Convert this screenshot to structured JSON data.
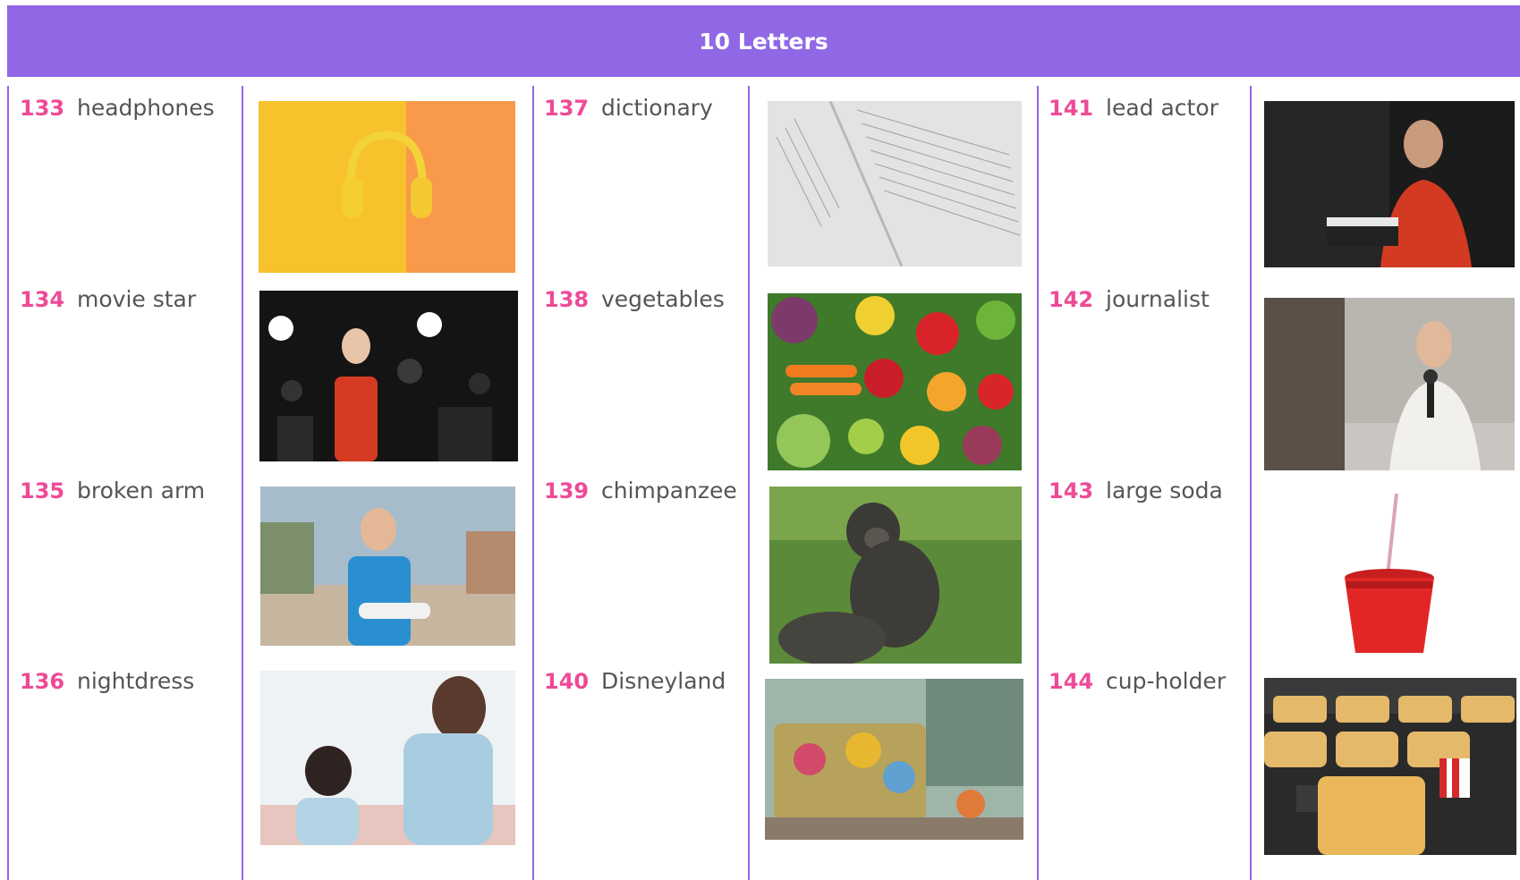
{
  "header": {
    "title": "10 Letters"
  },
  "columns": [
    {
      "items": [
        {
          "number": "133",
          "word": "headphones",
          "image": "headphones"
        },
        {
          "number": "134",
          "word": "movie star",
          "image": "movie-star"
        },
        {
          "number": "135",
          "word": "broken arm",
          "image": "broken-arm"
        },
        {
          "number": "136",
          "word": "nightdress",
          "image": "nightdress"
        }
      ]
    },
    {
      "items": [
        {
          "number": "137",
          "word": "dictionary",
          "image": "dictionary"
        },
        {
          "number": "138",
          "word": "vegetables",
          "image": "vegetables"
        },
        {
          "number": "139",
          "word": "chimpanzee",
          "image": "chimpanzee"
        },
        {
          "number": "140",
          "word": "Disneyland",
          "image": "disneyland"
        }
      ]
    },
    {
      "items": [
        {
          "number": "141",
          "word": "lead actor",
          "image": "lead-actor"
        },
        {
          "number": "142",
          "word": "journalist",
          "image": "journalist"
        },
        {
          "number": "143",
          "word": "large soda",
          "image": "large-soda"
        },
        {
          "number": "144",
          "word": "cup-holder",
          "image": "cup-holder"
        }
      ]
    }
  ],
  "colors": {
    "header": "#9068e6",
    "number": "#ee4a97",
    "word": "#555555",
    "divider": "#9068e6"
  }
}
